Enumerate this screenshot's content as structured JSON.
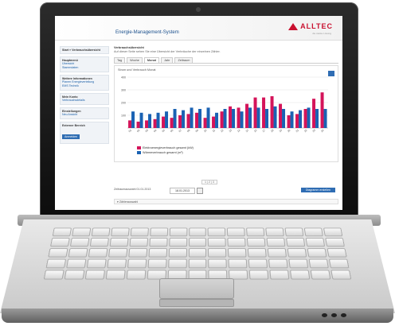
{
  "app": {
    "title": "Energie-Management-System",
    "logo_text": "ALLTEC",
    "logo_sub": "die starke Lösung"
  },
  "sidebar": {
    "sections": [
      {
        "title": "Start » Verbrauchsübersicht",
        "links": []
      },
      {
        "title": "Hauptmenü",
        "links": [
          "Übersicht",
          "Stammdaten"
        ]
      },
      {
        "title": "Weitere Informationen",
        "links": [
          "Planen Energieverteilung",
          "EMS Technik"
        ]
      },
      {
        "title": "Mein Konto",
        "links": [
          "Verbrauchsdetails"
        ]
      },
      {
        "title": "Einstellungen",
        "links": [
          "Neu Ansicht"
        ]
      },
      {
        "title": "Externer Bereich",
        "links": [],
        "button": "Anmelden"
      }
    ]
  },
  "main": {
    "intro_title": "Verbrauchsübersicht",
    "intro_text": "Auf dieser Seite sehen Sie eine Übersicht der Verbräuche der einzelnen Zähler.",
    "tabs": [
      "Tag",
      "Woche",
      "Monat",
      "Jahr",
      "Zeitraum"
    ],
    "active_tab": 2,
    "chart_title": "Strom und Verbrauch Monat",
    "pager": "1 | 2 | 3"
  },
  "chart_data": {
    "type": "bar",
    "categories": [
      "01",
      "02",
      "03",
      "04",
      "05",
      "06",
      "07",
      "08",
      "09",
      "10",
      "11",
      "12",
      "13",
      "14",
      "15",
      "16",
      "17",
      "18",
      "19",
      "20",
      "21",
      "22",
      "23",
      "24"
    ],
    "series": [
      {
        "name": "Elektroenergieverbrauch gesamt (kW)",
        "color": "#d4145a",
        "values": [
          60,
          50,
          60,
          70,
          90,
          80,
          100,
          110,
          120,
          80,
          90,
          130,
          170,
          160,
          190,
          240,
          240,
          250,
          190,
          100,
          110,
          150,
          230,
          280
        ]
      },
      {
        "name": "Wärmeverbrauch gesamt (m³)",
        "color": "#1a62b3",
        "values": [
          130,
          120,
          110,
          120,
          130,
          150,
          140,
          160,
          150,
          160,
          120,
          150,
          150,
          130,
          160,
          160,
          150,
          170,
          150,
          130,
          140,
          160,
          150,
          150
        ]
      }
    ],
    "ylim": [
      0,
      400
    ],
    "yticks": [
      100,
      200,
      300,
      400
    ],
    "grid": true,
    "legend_position": "bottom-left"
  },
  "form": {
    "field_label": "Zeitraumauswahl 01.01.2013",
    "date_value": "18.01.2013",
    "show_button": "Diagramm erstellen",
    "expander_label": "Zählerauswahl"
  }
}
